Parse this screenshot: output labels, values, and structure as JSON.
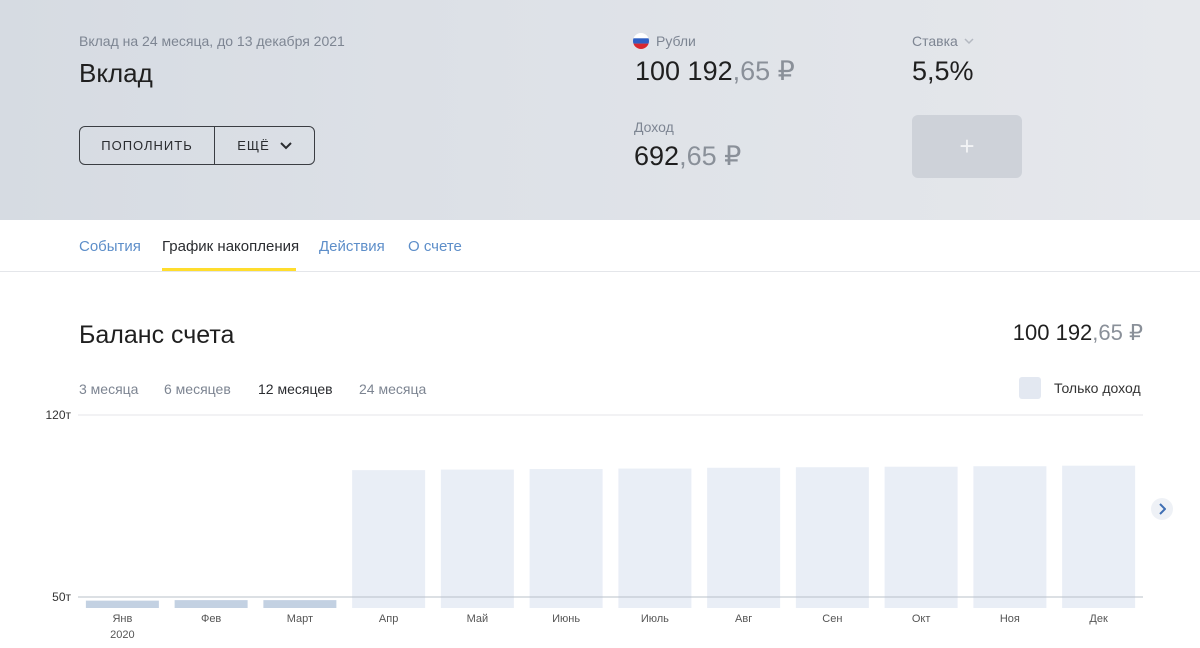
{
  "header": {
    "subtitle": "Вклад на 24 месяца, до 13 декабря 2021",
    "title": "Вклад",
    "refill_label": "ПОПОЛНИТЬ",
    "more_label": "ЕЩЁ",
    "currency_label": "Рубли",
    "balance_int": "100 192",
    "balance_frac": ",65 ₽",
    "income_label": "Доход",
    "income_int": "692",
    "income_frac": ",65 ₽",
    "rate_label": "Ставка",
    "rate_value": "5,5%",
    "plus_label": "+"
  },
  "tabs": [
    {
      "label": "События"
    },
    {
      "label": "График накопления"
    },
    {
      "label": "Действия"
    },
    {
      "label": "О счете"
    }
  ],
  "active_tab": 1,
  "section": {
    "title": "Баланс счета",
    "amount_int": "100 192",
    "amount_frac": ",65 ₽"
  },
  "periods": [
    {
      "label": "3 месяца"
    },
    {
      "label": "6 месяцев"
    },
    {
      "label": "12 месяцев"
    },
    {
      "label": "24 месяца"
    }
  ],
  "active_period": 2,
  "income_only_label": "Только доход",
  "colors": {
    "accent_yellow": "#ffdd2d",
    "link_blue": "#5d8ec9",
    "bar_past": "#c3d1e2",
    "bar_future": "#e9eef6"
  },
  "chart_data": {
    "type": "bar",
    "categories": [
      "Янв",
      "Фев",
      "Март",
      "Апр",
      "Май",
      "Июнь",
      "Июль",
      "Авг",
      "Сен",
      "Окт",
      "Ноя",
      "Дек"
    ],
    "year_label": "2020",
    "values": [
      48.6,
      48.8,
      48.8,
      98.8,
      99.0,
      99.2,
      99.4,
      99.7,
      99.9,
      100.1,
      100.3,
      100.5
    ],
    "past_count": 3,
    "ylim": [
      50,
      120
    ],
    "y_ticks": [
      {
        "value": 50,
        "label": "50т"
      },
      {
        "value": 120,
        "label": "120т"
      }
    ]
  }
}
